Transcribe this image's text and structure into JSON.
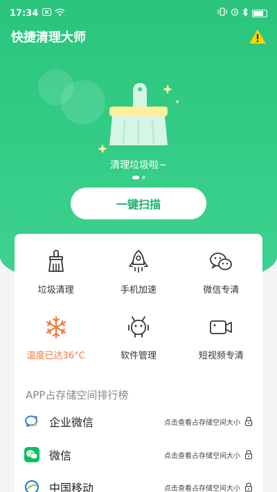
{
  "status_bar": {
    "time": "17:34",
    "icons": [
      "close-box-icon",
      "wifi-icon",
      "vibrate-icon",
      "alarm-icon",
      "bluetooth-icon",
      "battery-icon"
    ]
  },
  "app_bar": {
    "title": "快捷清理大师",
    "warning_icon": "warning-icon"
  },
  "hero": {
    "caption": "清理垃圾啦~",
    "carousel_page": 1,
    "carousel_total": 2
  },
  "scan_button": {
    "label": "一键扫描"
  },
  "tools": [
    {
      "label": "垃圾清理",
      "icon": "broom-icon"
    },
    {
      "label": "手机加速",
      "icon": "rocket-icon"
    },
    {
      "label": "微信专清",
      "icon": "wechat-icon"
    },
    {
      "label": "温度已达36°C",
      "icon": "snowflake-icon"
    },
    {
      "label": "软件管理",
      "icon": "robot-icon"
    },
    {
      "label": "短视频专清",
      "icon": "video-camera-icon"
    }
  ],
  "ranking": {
    "title": "APP占存储空间排行榜",
    "items": [
      {
        "name": "企业微信",
        "hint": "点击查看占存储空间大小",
        "icon": "wecom-icon"
      },
      {
        "name": "微信",
        "hint": "点击查看占存储空间大小",
        "icon": "wechat-app-icon"
      },
      {
        "name": "中国移动",
        "hint": "点击查看占存储空间大小",
        "icon": "china-mobile-icon"
      }
    ]
  },
  "colors": {
    "brand_green": "#2bc47c",
    "accent_orange": "#f07a3a",
    "warning_yellow": "#ffd400"
  }
}
